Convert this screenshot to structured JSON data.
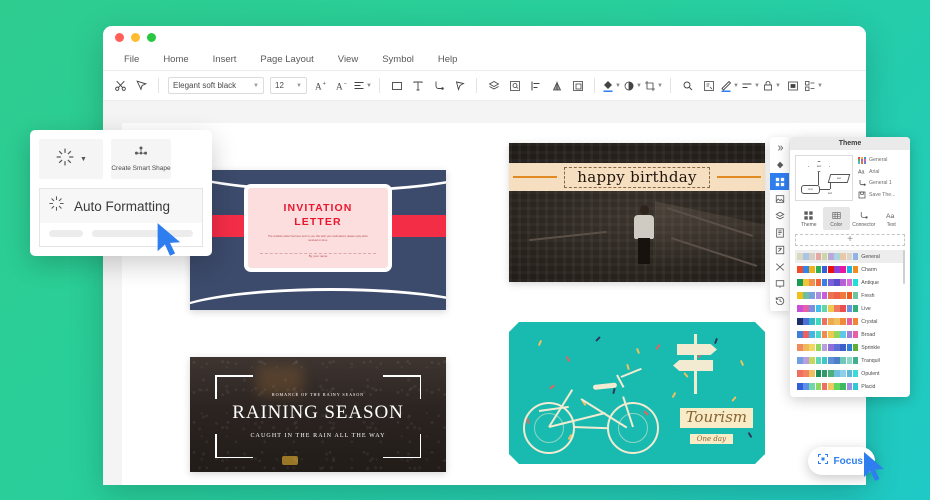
{
  "window": {
    "traffic_lights": [
      "close",
      "minimize",
      "maximize"
    ],
    "menu": [
      "File",
      "Home",
      "Insert",
      "Page Layout",
      "View",
      "Symbol",
      "Help"
    ]
  },
  "toolbar": {
    "font_name": "Elegant soft black",
    "font_size": "12",
    "icons": [
      "cut-icon",
      "format-painter-icon",
      "grow-font-icon",
      "shrink-font-icon",
      "align-icon",
      "rectangle-icon",
      "text-box-icon",
      "connector-icon",
      "pointer-icon",
      "layers-icon",
      "shape-select-icon",
      "align-left-icon",
      "flip-icon",
      "group-icon",
      "fill-color-icon",
      "shadow-icon",
      "crop-icon",
      "zoom-icon",
      "page-setup-icon",
      "pen-color-icon",
      "line-style-icon",
      "lock-icon",
      "frame-icon",
      "layout-icon"
    ]
  },
  "left_popup": {
    "dropdown_icon": "auto-format-icon",
    "smart_shape_label": "Create Smart Shape",
    "smart_shape_icon": "smart-shape-icon",
    "menu_item_label": "Auto Formatting",
    "menu_item_icon": "auto-format-icon"
  },
  "rail": {
    "items": [
      {
        "name": "collapse-icon"
      },
      {
        "name": "fill-icon"
      },
      {
        "name": "theme-grid-icon",
        "selected": true
      },
      {
        "name": "image-icon"
      },
      {
        "name": "layers-icon"
      },
      {
        "name": "document-icon"
      },
      {
        "name": "export-icon"
      },
      {
        "name": "shuffle-icon"
      },
      {
        "name": "present-icon"
      },
      {
        "name": "history-icon"
      }
    ]
  },
  "theme_panel": {
    "title": "Theme",
    "preview_nodes": [
      "text",
      "text",
      "text",
      "text"
    ],
    "properties": [
      {
        "icon": "color-grid-icon",
        "label": "General"
      },
      {
        "icon": "font-icon",
        "label": "Arial"
      },
      {
        "icon": "connector-icon",
        "label": "General 1"
      },
      {
        "icon": "save-icon",
        "label": "Save The..."
      }
    ],
    "tabs": [
      {
        "label": "Theme",
        "icon": "theme-icon",
        "selected": false
      },
      {
        "label": "Color",
        "icon": "color-icon",
        "selected": true
      },
      {
        "label": "Connector",
        "icon": "connector-icon",
        "selected": false
      },
      {
        "label": "Text",
        "icon": "text-icon",
        "selected": false
      }
    ],
    "add_label": "+",
    "color_themes": [
      {
        "name": "General",
        "selected": true,
        "swatches": [
          "#d9d9c0",
          "#a9c4e4",
          "#d7cfc4",
          "#e5a9a4",
          "#c9d6a8",
          "#b9a8d8",
          "#a9d4e0",
          "#e8c9a4",
          "#dbd6cb",
          "#8fb4e4"
        ]
      },
      {
        "name": "Charm",
        "selected": false,
        "swatches": [
          "#f24b2a",
          "#2f86e8",
          "#f0b418",
          "#2fae5a",
          "#3a5cd8",
          "#e8120e",
          "#8f3fd8",
          "#e817a0",
          "#17b8e8",
          "#f08c1a"
        ]
      },
      {
        "name": "Antique",
        "selected": false,
        "swatches": [
          "#1a9a52",
          "#efc53a",
          "#f0924a",
          "#f0653a",
          "#3a7ee8",
          "#7a5fd8",
          "#5a4fc8",
          "#b85fd8",
          "#d86fd8",
          "#1fe0d8"
        ]
      },
      {
        "name": "Fresh",
        "selected": false,
        "swatches": [
          "#f0c018",
          "#6fc0a0",
          "#7a9fe0",
          "#a88fe0",
          "#c85fd8",
          "#e8754f",
          "#f0604a",
          "#f07a3a",
          "#f0581f",
          "#6fc4a0"
        ]
      },
      {
        "name": "Live",
        "selected": false,
        "swatches": [
          "#c84fd8",
          "#e85fa8",
          "#7a8fe0",
          "#3fc0e8",
          "#5fd8a8",
          "#f0c84f",
          "#f07a5f",
          "#e84f4f",
          "#6f8fe0",
          "#2faf7a"
        ]
      },
      {
        "name": "Crystal",
        "selected": false,
        "swatches": [
          "#1f2f6a",
          "#4f6fd8",
          "#2fb8c8",
          "#3fd8c0",
          "#f0705f",
          "#f0a84f",
          "#f0c05f",
          "#f08a3a",
          "#e85f9f",
          "#f0853a"
        ]
      },
      {
        "name": "Broad",
        "selected": false,
        "swatches": [
          "#3f7fd8",
          "#f05f5f",
          "#3fb8e8",
          "#4fd8c8",
          "#f08a4f",
          "#f0c84f",
          "#8fd85f",
          "#5fc8e8",
          "#9f7fd8",
          "#e85fa8"
        ]
      },
      {
        "name": "Sprinkle",
        "selected": false,
        "swatches": [
          "#f08a5f",
          "#f0b85f",
          "#f0d85f",
          "#8fd85f",
          "#b89fe0",
          "#8f6fd8",
          "#5f6fd8",
          "#3f5fc8",
          "#2f7fd8",
          "#5fae3a"
        ]
      },
      {
        "name": "Tranquil",
        "selected": false,
        "swatches": [
          "#6f9fe0",
          "#b89fe0",
          "#c8d85f",
          "#5fd8b8",
          "#3fc8c8",
          "#5f8fd8",
          "#4f7fc8",
          "#6fc8b8",
          "#8fd8c8",
          "#3faf8f"
        ]
      },
      {
        "name": "Opulent",
        "selected": false,
        "swatches": [
          "#f0705f",
          "#f0855f",
          "#f0c05f",
          "#1f8a5a",
          "#2f9a6a",
          "#4faf7a",
          "#6fc0e0",
          "#8fd0e8",
          "#5fb8d8",
          "#3fd8d8"
        ]
      },
      {
        "name": "Placid",
        "selected": false,
        "swatches": [
          "#2f5fd8",
          "#5f8fe8",
          "#6fd8a8",
          "#8fd85f",
          "#f0705f",
          "#f0c85f",
          "#5fd85f",
          "#3fb85f",
          "#9f8fe0",
          "#2fc8d8"
        ]
      }
    ]
  },
  "focus": {
    "label": "Focus",
    "icon": "focus-icon"
  },
  "slides": [
    {
      "name": "invitation-letter",
      "title": "INVITATION LETTER",
      "title_line1": "INVITATION",
      "title_line2": "LETTER",
      "body": "The invitation letter has been sent to you. We wish you could attend, please reply when received on time.",
      "signature": "By your name"
    },
    {
      "name": "happy-birthday",
      "title": "happy birthday"
    },
    {
      "name": "raining-season",
      "eyebrow": "ROMANCE OF THE RAINY SEASON",
      "title": "RAINING SEASON",
      "subtitle": "CAUGHT IN THE RAIN ALL THE WAY"
    },
    {
      "name": "tourism",
      "title": "Tourism",
      "subtitle": "One day"
    }
  ],
  "colors": {
    "accent_blue": "#2f7ef0",
    "app_bg": "#f4f4f4",
    "desktop_gradient_start": "#2ecc8f",
    "desktop_gradient_end": "#1fc9c6"
  }
}
